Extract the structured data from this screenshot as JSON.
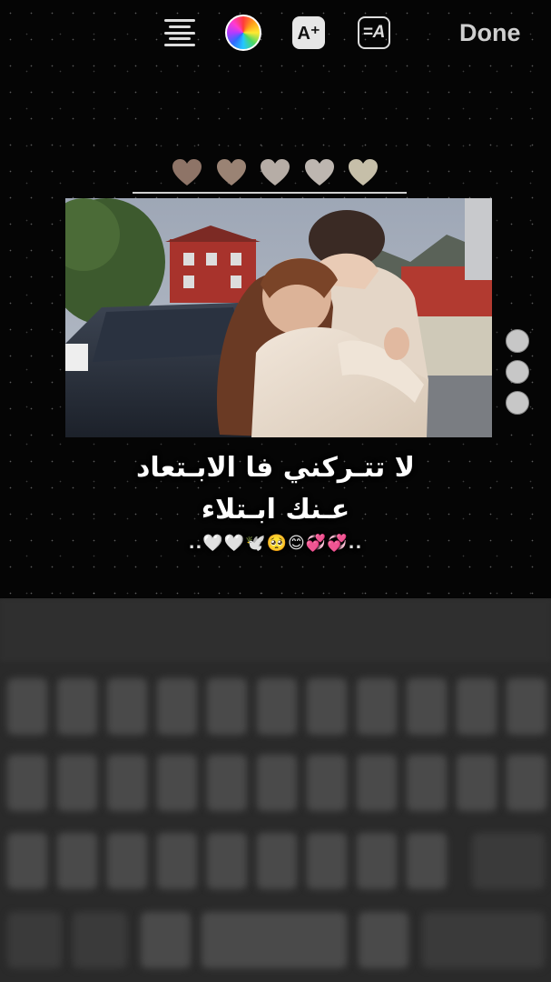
{
  "toolbar": {
    "align_icon": "text-align-center-icon",
    "color_icon": "color-wheel-icon",
    "font_size_icon": "font-size-increase-icon",
    "font_size_label": "A⁺",
    "text_style_icon": "text-style-icon",
    "text_style_label": "=A",
    "done_label": "Done"
  },
  "hearts": {
    "icon": "heart-icon",
    "count": 5,
    "color": "#b9a89c"
  },
  "photo": {
    "description_icon": "couple-photo"
  },
  "caption": {
    "line1": "لا تتـركني فا الابـتعاد",
    "line2": "عـنك ابـتلاء",
    "line3": "..💞💞😊🥺🕊️🤍🤍.."
  },
  "colors": {
    "background": "#050505",
    "keyboard": "#2a2a2a",
    "done_text": "#cfcfcf"
  }
}
